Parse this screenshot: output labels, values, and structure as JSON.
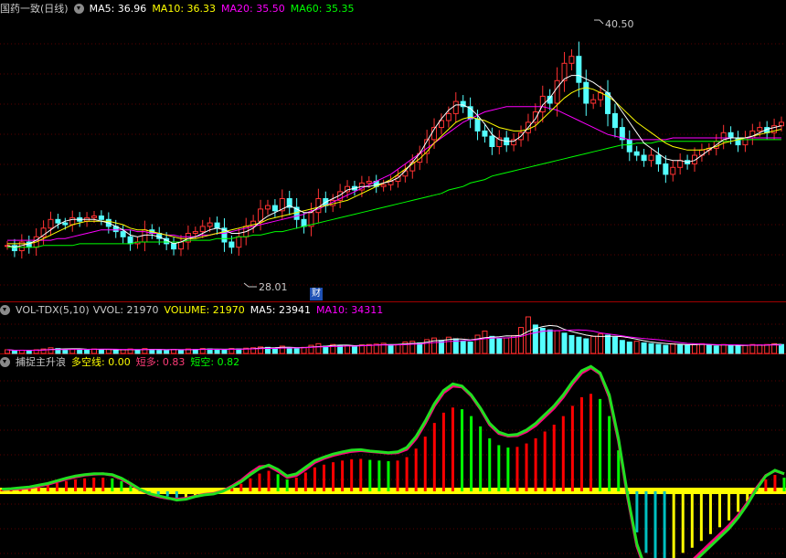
{
  "colors": {
    "up": "#ff3232",
    "down": "#54ffff",
    "ma5": "#ffffff",
    "ma10": "#ffff00",
    "ma20": "#ff00ff",
    "ma60": "#00ff00",
    "bull": "#ff0000",
    "bear": "#00ff00",
    "yellow": "#ffff00",
    "cyan": "#00c0c0",
    "magenta": "#ff0080"
  },
  "price_panel": {
    "title": "国药一致(日线)",
    "ma5": "MA5: 36.96",
    "ma10": "MA10: 36.33",
    "ma20": "MA20: 35.50",
    "ma60": "MA60: 35.35",
    "high_label": "40.50",
    "low_label": "28.01",
    "event_badge": "财"
  },
  "volume_panel": {
    "title": "VOL-TDX(5,10)",
    "vvol": "VVOL: 21970",
    "volume": "VOLUME: 21970",
    "ma5": "MA5: 23941",
    "ma10": "MA10: 34311"
  },
  "indicator_panel": {
    "title": "捕捉主升浪",
    "duokong": "多空线: 0.00",
    "duanduo": "短多: 0.83",
    "duankong": "短空: 0.82"
  },
  "chart_data": [
    {
      "type": "candlestick",
      "title": "国药一致(日线)",
      "ylim": [
        26.5,
        42.5
      ],
      "close": [
        29.3,
        29.0,
        29.5,
        29.2,
        29.8,
        30.3,
        30.8,
        30.6,
        30.5,
        30.9,
        30.7,
        30.9,
        31.0,
        30.8,
        30.4,
        30.1,
        29.8,
        29.4,
        29.5,
        30.2,
        30.0,
        29.7,
        29.4,
        29.1,
        29.5,
        30.0,
        30.1,
        30.4,
        30.6,
        30.3,
        29.5,
        29.2,
        29.8,
        30.4,
        30.7,
        31.4,
        31.6,
        31.3,
        32.0,
        31.5,
        30.8,
        30.4,
        31.2,
        32.0,
        31.6,
        31.9,
        32.4,
        32.7,
        32.5,
        32.9,
        33.0,
        32.7,
        32.8,
        33.0,
        33.3,
        33.6,
        34.1,
        34.6,
        35.4,
        36.1,
        36.5,
        36.9,
        37.6,
        37.3,
        36.6,
        35.9,
        35.6,
        35.0,
        35.5,
        35.1,
        35.4,
        35.8,
        36.4,
        37.0,
        37.9,
        37.5,
        38.8,
        39.8,
        40.2,
        38.7,
        37.5,
        37.7,
        38.1,
        36.9,
        36.1,
        35.4,
        34.7,
        34.5,
        34.2,
        34.5,
        34.0,
        33.4,
        33.8,
        34.2,
        34.0,
        34.5,
        34.8,
        34.9,
        35.3,
        35.8,
        35.5,
        35.1,
        35.5,
        35.9,
        36.1,
        35.8,
        36.2,
        36.4
      ],
      "ma5": [
        29.3,
        29.2,
        29.3,
        29.4,
        29.6,
        29.9,
        30.2,
        30.5,
        30.7,
        30.8,
        30.8,
        30.8,
        30.8,
        30.7,
        30.6,
        30.4,
        30.2,
        29.9,
        29.8,
        29.9,
        29.9,
        29.8,
        29.6,
        29.4,
        29.5,
        29.7,
        29.8,
        30.0,
        30.2,
        30.3,
        30.2,
        30.0,
        30.0,
        30.1,
        30.3,
        30.7,
        31.0,
        31.2,
        31.4,
        31.6,
        31.4,
        31.2,
        31.2,
        31.5,
        31.8,
        32.0,
        32.2,
        32.5,
        32.6,
        32.7,
        32.7,
        32.8,
        32.9,
        33.0,
        33.2,
        33.6,
        34.1,
        34.6,
        35.3,
        36.0,
        36.6,
        37.1,
        37.4,
        37.4,
        37.2,
        36.8,
        36.3,
        35.7,
        35.4,
        35.3,
        35.3,
        35.6,
        36.1,
        36.6,
        37.4,
        37.8,
        38.4,
        38.9,
        39.1,
        39.1,
        38.9,
        38.7,
        38.4,
        38.1,
        37.6,
        37.0,
        36.4,
        35.8,
        35.2,
        34.9,
        34.6,
        34.3,
        34.2,
        34.2,
        34.1,
        34.2,
        34.5,
        34.8,
        35.1,
        35.4,
        35.5,
        35.5,
        35.5,
        35.6,
        35.8,
        36.0,
        36.1,
        36.2
      ],
      "ma10": [
        29.4,
        29.4,
        29.4,
        29.4,
        29.5,
        29.7,
        29.9,
        30.1,
        30.3,
        30.5,
        30.6,
        30.7,
        30.7,
        30.7,
        30.7,
        30.6,
        30.5,
        30.3,
        30.2,
        30.2,
        30.1,
        30.0,
        29.9,
        29.8,
        29.7,
        29.7,
        29.7,
        29.8,
        29.9,
        30.0,
        30.1,
        30.2,
        30.3,
        30.4,
        30.5,
        30.6,
        30.8,
        30.9,
        31.0,
        31.1,
        31.2,
        31.3,
        31.4,
        31.5,
        31.6,
        31.7,
        31.8,
        31.9,
        32.1,
        32.3,
        32.5,
        32.7,
        32.9,
        33.1,
        33.4,
        33.7,
        34.0,
        34.3,
        34.7,
        35.2,
        35.6,
        36.0,
        36.4,
        36.6,
        36.7,
        36.6,
        36.5,
        36.3,
        36.1,
        36.0,
        35.9,
        35.9,
        36.0,
        36.2,
        36.6,
        37.0,
        37.4,
        37.8,
        38.1,
        38.3,
        38.4,
        38.3,
        38.1,
        37.9,
        37.6,
        37.2,
        36.8,
        36.4,
        36.1,
        35.8,
        35.5,
        35.2,
        35.0,
        34.9,
        34.8,
        34.8,
        34.8,
        34.9,
        35.0,
        35.2,
        35.3,
        35.4,
        35.5,
        35.6,
        35.7,
        35.8,
        35.9,
        36.0
      ],
      "ma20": [
        29.6,
        29.6,
        29.6,
        29.6,
        29.6,
        29.6,
        29.6,
        29.7,
        29.7,
        29.8,
        29.9,
        30.0,
        30.1,
        30.2,
        30.2,
        30.2,
        30.2,
        30.2,
        30.1,
        30.1,
        30.0,
        30.0,
        29.9,
        29.9,
        29.8,
        29.8,
        29.8,
        29.9,
        29.9,
        30.0,
        30.0,
        30.1,
        30.2,
        30.3,
        30.4,
        30.5,
        30.6,
        30.7,
        30.8,
        30.9,
        31.0,
        31.1,
        31.3,
        31.4,
        31.6,
        31.8,
        32.0,
        32.2,
        32.4,
        32.6,
        32.8,
        33.0,
        33.2,
        33.4,
        33.7,
        34.0,
        34.3,
        34.6,
        34.9,
        35.2,
        35.5,
        35.8,
        36.1,
        36.4,
        36.6,
        36.8,
        37.0,
        37.1,
        37.2,
        37.3,
        37.3,
        37.3,
        37.3,
        37.3,
        37.3,
        37.2,
        37.1,
        36.9,
        36.7,
        36.5,
        36.3,
        36.1,
        35.9,
        35.7,
        35.6,
        35.5,
        35.4,
        35.4,
        35.4,
        35.4,
        35.4,
        35.4,
        35.5,
        35.5,
        35.5,
        35.5,
        35.5,
        35.5,
        35.5,
        35.5,
        35.5,
        35.5,
        35.5,
        35.5,
        35.5,
        35.5,
        35.5,
        35.5
      ],
      "ma60": [
        29.2,
        29.2,
        29.2,
        29.2,
        29.2,
        29.3,
        29.3,
        29.3,
        29.3,
        29.3,
        29.4,
        29.4,
        29.4,
        29.4,
        29.4,
        29.4,
        29.4,
        29.4,
        29.5,
        29.5,
        29.5,
        29.5,
        29.5,
        29.5,
        29.5,
        29.6,
        29.6,
        29.6,
        29.6,
        29.7,
        29.7,
        29.7,
        29.8,
        29.8,
        29.9,
        29.9,
        30.0,
        30.1,
        30.1,
        30.2,
        30.3,
        30.4,
        30.5,
        30.6,
        30.7,
        30.8,
        30.9,
        31.0,
        31.1,
        31.2,
        31.3,
        31.4,
        31.5,
        31.6,
        31.7,
        31.8,
        31.9,
        32.0,
        32.1,
        32.2,
        32.3,
        32.5,
        32.6,
        32.7,
        32.9,
        33.0,
        33.1,
        33.3,
        33.4,
        33.5,
        33.6,
        33.7,
        33.8,
        33.9,
        34.0,
        34.1,
        34.2,
        34.3,
        34.4,
        34.5,
        34.6,
        34.7,
        34.8,
        34.9,
        35.0,
        35.1,
        35.1,
        35.2,
        35.2,
        35.2,
        35.3,
        35.3,
        35.3,
        35.3,
        35.3,
        35.3,
        35.3,
        35.3,
        35.3,
        35.3,
        35.3,
        35.4,
        35.4,
        35.4,
        35.4,
        35.4,
        35.4,
        35.4
      ],
      "high": 40.5,
      "low": 28.01
    },
    {
      "type": "bar",
      "title": "VOL-TDX(5,10)",
      "series": [
        {
          "name": "VOLUME",
          "values": [
            9,
            7,
            8,
            7,
            9,
            11,
            14,
            12,
            10,
            11,
            10,
            9,
            11,
            9,
            10,
            8,
            9,
            11,
            8,
            12,
            10,
            9,
            8,
            10,
            9,
            11,
            10,
            12,
            11,
            10,
            9,
            12,
            11,
            13,
            14,
            16,
            15,
            13,
            18,
            14,
            12,
            15,
            20,
            24,
            18,
            22,
            19,
            20,
            17,
            21,
            22,
            23,
            25,
            19,
            22,
            28,
            30,
            26,
            34,
            38,
            32,
            40,
            36,
            30,
            28,
            45,
            55,
            42,
            36,
            38,
            44,
            64,
            90,
            70,
            62,
            58,
            56,
            50,
            44,
            40,
            36,
            42,
            48,
            45,
            40,
            32,
            28,
            30,
            26,
            24,
            22,
            20,
            24,
            22,
            20,
            22,
            24,
            20,
            18,
            22,
            20,
            18,
            20,
            22,
            21,
            22,
            24,
            22
          ]
        }
      ]
    },
    {
      "type": "bar",
      "title": "捕捉主升浪",
      "series": [
        {
          "name": "短多",
          "values": [
            0.05,
            0.06,
            0.08,
            0.1,
            0.14,
            0.18,
            0.24,
            0.3,
            0.35,
            0.38,
            0.4,
            0.4,
            0.38,
            0.3,
            0.18,
            0.05,
            -0.05,
            -0.1,
            -0.15,
            -0.2,
            -0.18,
            -0.12,
            -0.08,
            -0.06,
            0.0,
            0.1,
            0.22,
            0.38,
            0.52,
            0.6,
            0.5,
            0.35,
            0.4,
            0.55,
            0.7,
            0.78,
            0.85,
            0.9,
            0.94,
            0.95,
            0.92,
            0.9,
            0.88,
            0.9,
            1.0,
            1.25,
            1.6,
            2.0,
            2.3,
            2.45,
            2.4,
            2.2,
            1.9,
            1.55,
            1.35,
            1.28,
            1.3,
            1.4,
            1.55,
            1.75,
            1.95,
            2.2,
            2.5,
            2.75,
            2.85,
            2.7,
            2.2,
            1.2,
            -0.1,
            -1.2,
            -1.8,
            -2.1,
            -2.1,
            -1.95,
            -1.8,
            -1.65,
            -1.45,
            -1.25,
            -1.05,
            -0.85,
            -0.6,
            -0.3,
            0.05,
            0.35,
            0.48,
            0.4
          ]
        },
        {
          "name": "短空",
          "values": [
            0.04,
            0.05,
            0.06,
            0.08,
            0.12,
            0.16,
            0.22,
            0.28,
            0.33,
            0.37,
            0.39,
            0.4,
            0.37,
            0.28,
            0.16,
            0.04,
            -0.06,
            -0.12,
            -0.16,
            -0.18,
            -0.16,
            -0.11,
            -0.07,
            -0.05,
            0.01,
            0.12,
            0.25,
            0.42,
            0.56,
            0.58,
            0.46,
            0.32,
            0.36,
            0.5,
            0.66,
            0.75,
            0.82,
            0.87,
            0.91,
            0.93,
            0.91,
            0.89,
            0.87,
            0.88,
            0.96,
            1.2,
            1.55,
            1.95,
            2.25,
            2.4,
            2.38,
            2.18,
            1.88,
            1.52,
            1.32,
            1.26,
            1.27,
            1.36,
            1.5,
            1.7,
            1.9,
            2.15,
            2.45,
            2.7,
            2.82,
            2.68,
            2.15,
            1.15,
            -0.15,
            -1.25,
            -1.85,
            -2.15,
            -2.08,
            -1.9,
            -1.74,
            -1.58,
            -1.38,
            -1.18,
            -0.98,
            -0.78,
            -0.55,
            -0.26,
            0.08,
            0.36,
            0.47,
            0.4
          ]
        },
        {
          "name": "多空线",
          "values": [
            0.0
          ]
        }
      ]
    }
  ]
}
